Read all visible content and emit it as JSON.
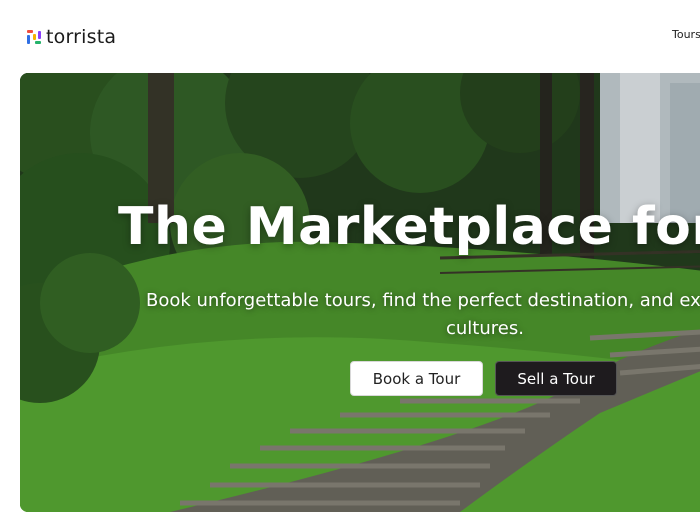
{
  "header": {
    "brand": "torrista",
    "nav_tours": "Tours"
  },
  "hero": {
    "title": "The Marketplace for",
    "subtitle_line1": "Book unforgettable tours, find the perfect destination, and ex",
    "subtitle_line2": "cultures.",
    "book_button": "Book a Tour",
    "sell_button": "Sell a Tour"
  },
  "colors": {
    "primary_dark": "#1e1b1e",
    "text": "#222222"
  }
}
